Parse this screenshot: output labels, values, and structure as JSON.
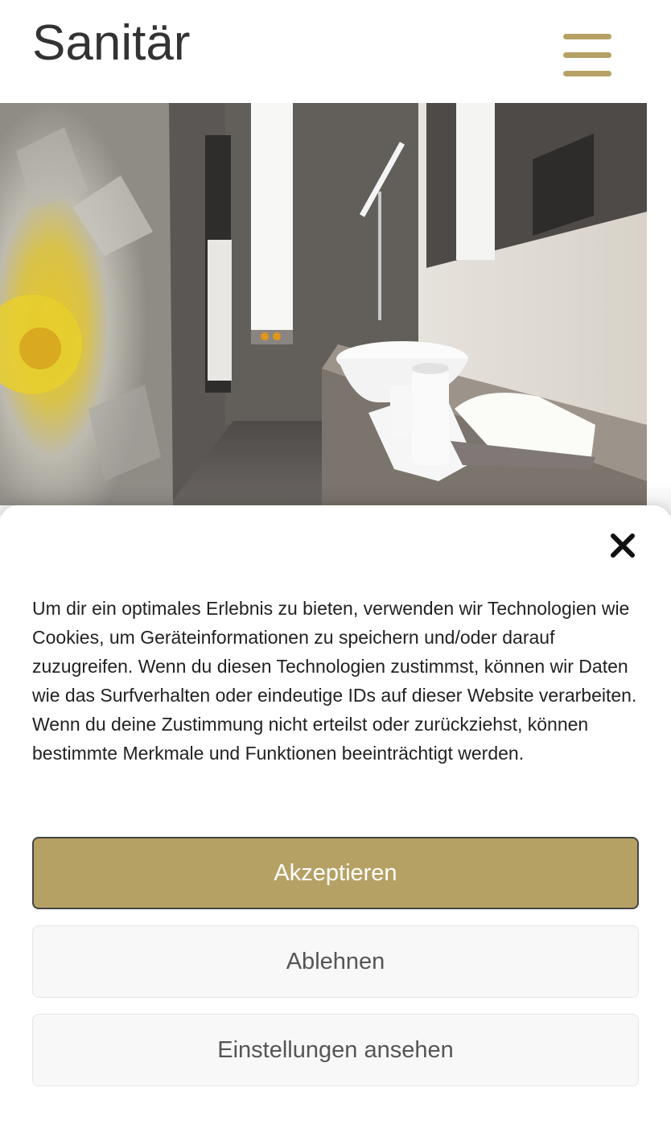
{
  "header": {
    "title": "Sanitär",
    "menu_icon": "hamburger-menu-icon"
  },
  "hero": {
    "image_subject": "bathroom-interior-photo"
  },
  "cookie_banner": {
    "close_icon": "close-icon",
    "text": "Um dir ein optimales Erlebnis zu bieten, verwenden wir Technologien wie Cookies, um Geräteinformationen zu speichern und/oder darauf zuzugreifen. Wenn du diesen Technologien zustimmst, können wir Daten wie das Surfverhalten oder eindeutige IDs auf dieser Website verarbeiten. Wenn du deine Zustimmung nicht erteilst oder zurückziehst, können bestimmte Merkmale und Funktionen beeinträchtigt werden.",
    "accept_label": "Akzeptieren",
    "deny_label": "Ablehnen",
    "settings_label": "Einstellungen ansehen"
  },
  "colors": {
    "accent": "#b6a165",
    "text": "#333333",
    "button_secondary_bg": "#f8f8f8"
  }
}
